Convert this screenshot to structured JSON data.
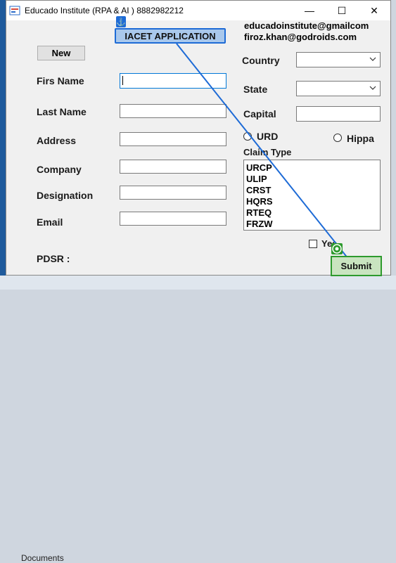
{
  "window": {
    "title": "Educado Institute (RPA & AI ) 8882982212",
    "minimize_glyph": "—",
    "maximize_glyph": "☐",
    "close_glyph": "✕"
  },
  "header": {
    "email_1": "educadoinstitute@gmailcom",
    "email_2": "firoz.khan@godroids.com",
    "application_badge": "IACET APPLICATION",
    "anchor_glyph": "⚓"
  },
  "buttons": {
    "new_label": "New",
    "submit_label": "Submit"
  },
  "form": {
    "first_name_label": "Firs Name",
    "last_name_label": "Last Name",
    "address_label": "Address",
    "company_label": "Company",
    "designation_label": "Designation",
    "email_label": "Email",
    "pdsr_label": "PDSR :",
    "country_label": "Country",
    "state_label": "State",
    "capital_label": "Capital",
    "urd_label": "URD",
    "hippa_label": "Hippa",
    "claim_type_label": "Claim Type",
    "yes_label": "Yes"
  },
  "claim_types": [
    "URCP",
    "ULIP",
    "CRST",
    "HQRS",
    "RTEQ",
    "FRZW"
  ],
  "background": {
    "taskbar_item": "Documents"
  },
  "colors": {
    "anchor_highlight": "#1e6bd6",
    "target_highlight": "#2d9a2d",
    "link_line": "#1e6bd6"
  },
  "icons": [
    "app-icon",
    "anchor-icon",
    "chevron-down-icon",
    "target-icon"
  ]
}
